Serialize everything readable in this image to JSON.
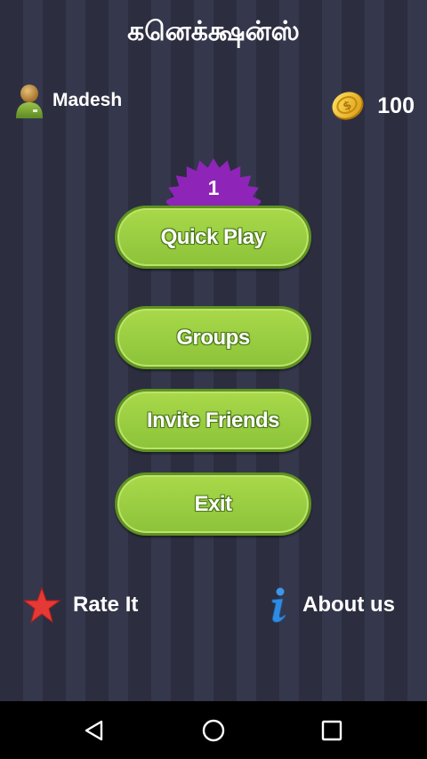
{
  "app": {
    "title": "கனெக்க்ஷன்ஸ்"
  },
  "user": {
    "name": "Madesh",
    "avatar_icon": "user-avatar-icon"
  },
  "coins": {
    "count": "100",
    "icon": "gold-coin-icon"
  },
  "level_badge": {
    "value": "1",
    "color": "#8e24b8"
  },
  "menu": {
    "quick_play": "Quick Play",
    "groups": "Groups",
    "invite_friends": "Invite Friends",
    "exit": "Exit"
  },
  "footer": {
    "rate_label": "Rate It",
    "rate_icon": "star-icon",
    "about_label": "About us",
    "about_icon": "info-icon"
  },
  "navbar": {
    "back_icon": "back-triangle-icon",
    "home_icon": "home-circle-icon",
    "recents_icon": "recents-square-icon"
  },
  "colors": {
    "button_green": "#9acd40",
    "background": "#2c2e40",
    "star_red": "#e53935",
    "info_blue": "#2f8be0"
  }
}
